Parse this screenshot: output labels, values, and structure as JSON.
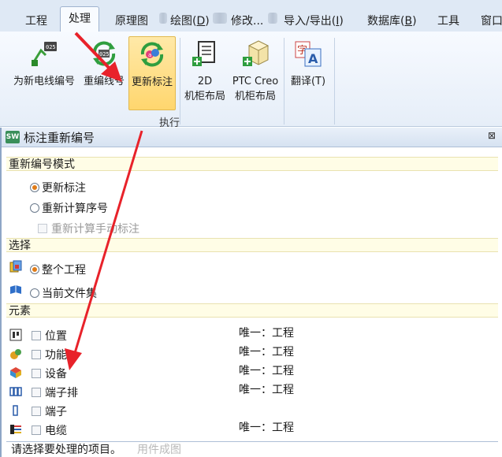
{
  "tabs": {
    "items": [
      {
        "label": "工程"
      },
      {
        "label": "处理"
      },
      {
        "label": "原理图"
      },
      {
        "label": "绘图(",
        "mnemonic": "D",
        "suffix": ")"
      },
      {
        "label": "修改..."
      },
      {
        "label": "导入/导出(",
        "mnemonic": "I",
        "suffix": ")"
      },
      {
        "label": "数据库(",
        "mnemonic": "B",
        "suffix": ")"
      },
      {
        "label": "工具"
      },
      {
        "label": "窗口"
      }
    ]
  },
  "ribbon": {
    "buttons": [
      {
        "line1": "为新电线编号",
        "line2": ""
      },
      {
        "line1": "重编线号",
        "line2": ""
      },
      {
        "line1": "更新标注",
        "line2": ""
      },
      {
        "line1": "2D",
        "line2": "机柜布局"
      },
      {
        "line1": "PTC Creo",
        "line2": "机柜布局"
      },
      {
        "line1": "翻译(T)",
        "line2": ""
      }
    ],
    "group_label": "执行"
  },
  "panel": {
    "title": "标注重新编号",
    "close_glyph": "⊠",
    "icon_text": "SW",
    "sections": {
      "mode": "重新编号模式",
      "selection": "选择",
      "elements": "元素"
    },
    "mode_options": [
      {
        "label": "更新标注",
        "selected": true
      },
      {
        "label": "重新计算序号",
        "selected": false
      }
    ],
    "manual_check": "重新计算手动标注",
    "selection_options": [
      {
        "label": "整个工程",
        "selected": true
      },
      {
        "label": "当前文件集",
        "selected": false
      }
    ],
    "elements": [
      {
        "label": "位置",
        "icon": "location-icon",
        "unique": "唯一：工程"
      },
      {
        "label": "功能",
        "icon": "function-icon",
        "unique": "唯一：工程"
      },
      {
        "label": "设备",
        "icon": "component-icon",
        "unique": "唯一：工程"
      },
      {
        "label": "端子排",
        "icon": "terminal-strip-icon",
        "unique": "唯一：工程"
      },
      {
        "label": "端子",
        "icon": "terminal-icon",
        "unique": ""
      },
      {
        "label": "电缆",
        "icon": "cable-icon",
        "unique": "唯一：工程"
      }
    ],
    "status": "请选择要处理的项目。",
    "status_ghost": "用件成图"
  },
  "colors": {
    "accent": "#e07b17",
    "highlight": "#ffd66e",
    "annotation_arrow": "#e8222a"
  }
}
